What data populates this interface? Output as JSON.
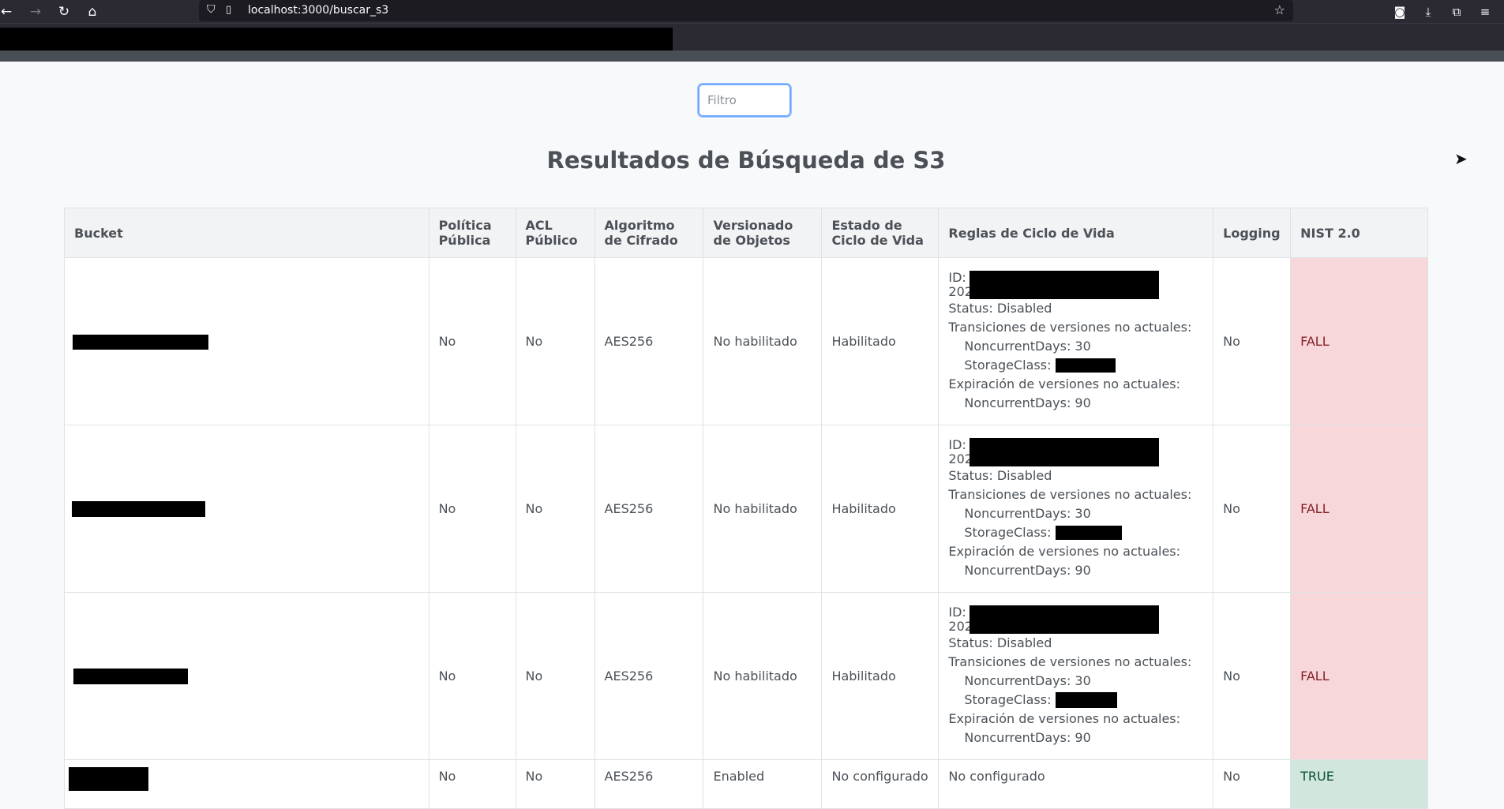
{
  "browser": {
    "url": "localhost:3000/buscar_s3",
    "nav": {
      "back": "←",
      "forward": "→",
      "reload": "↻",
      "home": "⌂"
    }
  },
  "filter": {
    "placeholder": "Filtro"
  },
  "page_title": "Resultados de Búsqueda de S3",
  "table": {
    "headers": {
      "bucket": "Bucket",
      "politica_1": "Política",
      "politica_2": "Pública",
      "acl_1": "ACL",
      "acl_2": "Público",
      "algo_1": "Algoritmo",
      "algo_2": "de Cifrado",
      "vers_1": "Versionado",
      "vers_2": "de Objetos",
      "estado_1": "Estado de",
      "estado_2": "Ciclo de Vida",
      "reglas": "Reglas de Ciclo de Vida",
      "logging": "Logging",
      "nist": "NIST 2.0"
    },
    "rows": [
      {
        "politica": "No",
        "acl": "No",
        "algoritmo": "AES256",
        "versionado": "No habilitado",
        "estado": "Habilitado",
        "reglas": {
          "id_label": "ID:",
          "id_prefix": "202",
          "status": "Status: Disabled",
          "transiciones": "Transiciones de versiones no actuales:",
          "noncurrent_days_trans": "NoncurrentDays: 30",
          "storage_class": "StorageClass:",
          "expiracion": "Expiración de versiones no actuales:",
          "noncurrent_days_exp": "NoncurrentDays: 90"
        },
        "logging": "No",
        "nist": "FALL"
      },
      {
        "politica": "No",
        "acl": "No",
        "algoritmo": "AES256",
        "versionado": "No habilitado",
        "estado": "Habilitado",
        "reglas": {
          "id_label": "ID:",
          "id_prefix": "202",
          "status": "Status: Disabled",
          "transiciones": "Transiciones de versiones no actuales:",
          "noncurrent_days_trans": "NoncurrentDays: 30",
          "storage_class": "StorageClass:",
          "expiracion": "Expiración de versiones no actuales:",
          "noncurrent_days_exp": "NoncurrentDays: 90"
        },
        "logging": "No",
        "nist": "FALL"
      },
      {
        "politica": "No",
        "acl": "No",
        "algoritmo": "AES256",
        "versionado": "No habilitado",
        "estado": "Habilitado",
        "reglas": {
          "id_label": "ID:",
          "id_prefix": "202",
          "status": "Status: Disabled",
          "transiciones": "Transiciones de versiones no actuales:",
          "noncurrent_days_trans": "NoncurrentDays: 30",
          "storage_class": "StorageClass:",
          "expiracion": "Expiración de versiones no actuales:",
          "noncurrent_days_exp": "NoncurrentDays: 90"
        },
        "logging": "No",
        "nist": "FALL"
      },
      {
        "politica": "No",
        "acl": "No",
        "algoritmo": "AES256",
        "versionado": "Enabled",
        "estado": "No configurado",
        "reglas_text": "No configurado",
        "logging": "No",
        "nist": "TRUE"
      }
    ]
  },
  "colors": {
    "fail_bg": "#f8d7da",
    "fail_text": "#842029",
    "ok_bg": "#d1e7dd",
    "ok_text": "#0f5132"
  }
}
